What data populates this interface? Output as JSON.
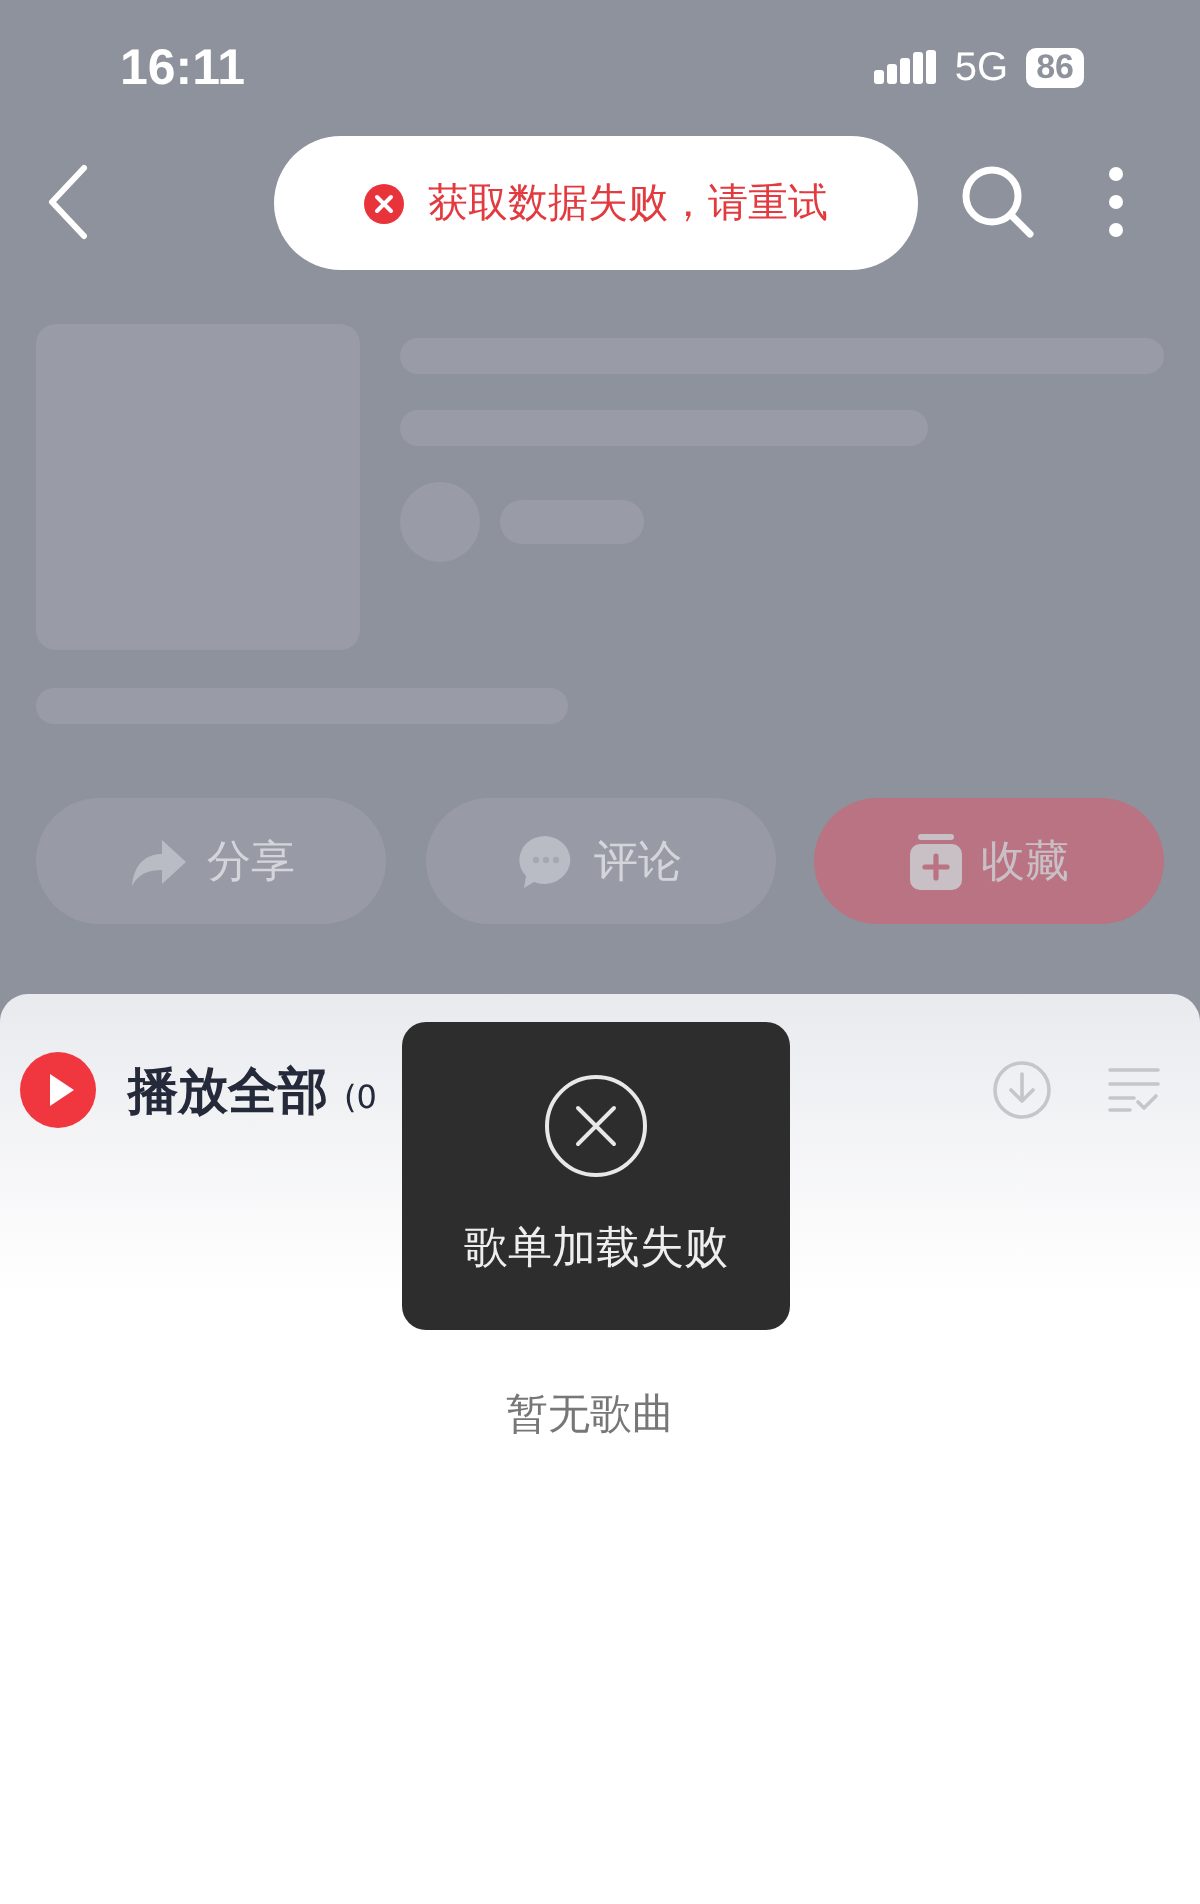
{
  "status_bar": {
    "time": "16:11",
    "network": "5G",
    "battery": "86"
  },
  "top_toast": {
    "text": "获取数据失败，请重试"
  },
  "actions": [
    {
      "label": "分享",
      "kind": "share"
    },
    {
      "label": "评论",
      "kind": "comment"
    },
    {
      "label": "收藏",
      "kind": "collect"
    }
  ],
  "playlist": {
    "play_all": "播放全部",
    "count": "(0"
  },
  "error_dialog": {
    "text": "歌单加载失败"
  },
  "empty_text": "暂无歌曲"
}
